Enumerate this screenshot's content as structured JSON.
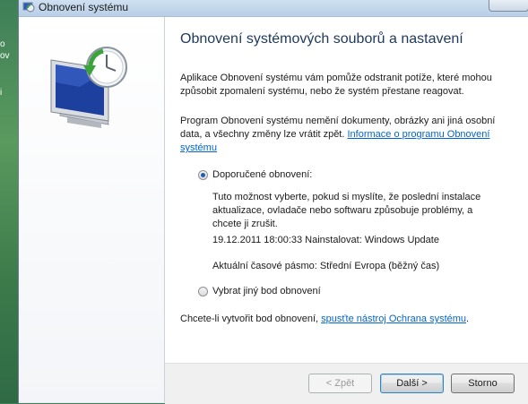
{
  "desktop": {
    "fragments": [
      "o",
      "ov",
      "i"
    ]
  },
  "window": {
    "title": "Obnovení systému",
    "heading": "Obnovení systémových souborů a nastavení",
    "intro": "Aplikace Obnovení systému vám pomůže odstranit potíže, které mohou způsobit zpomalení systému, nebo že systém přestane reagovat.",
    "info_text": "Program Obnovení systému nemění dokumenty, obrázky ani jiná osobní data, a všechny změny lze vrátit zpět.",
    "info_link": "Informace o programu Obnovení systému",
    "options": {
      "recommended": {
        "label": "Doporučené obnovení:",
        "selected": true,
        "description": "Tuto možnost vyberte, pokud si myslíte, že poslední instalace aktualizace, ovladače nebo softwaru způsobuje problémy, a chcete ji zrušit.",
        "restore_point": "19.12.2011 18:00:33 Nainstalovat: Windows Update",
        "timezone": "Aktuální časové pásmo: Střední Evropa (běžný čas)"
      },
      "other": {
        "label": "Vybrat jiný bod obnovení",
        "selected": false
      }
    },
    "create_point_text": "Chcete-li vytvořit bod obnovení,",
    "create_point_link": "spusťte nástroj Ochrana systému",
    "create_point_end": ".",
    "buttons": {
      "back": "< Zpět",
      "next": "Další >",
      "cancel": "Storno"
    }
  }
}
